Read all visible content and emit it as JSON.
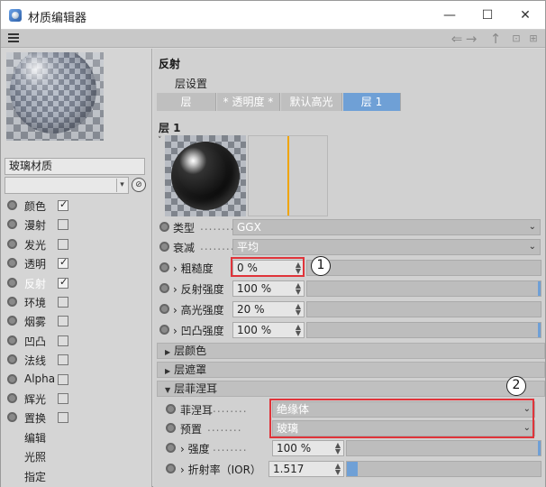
{
  "window": {
    "title": "材质编辑器",
    "minimize": "—",
    "maximize": "☐",
    "close": "✕"
  },
  "toolbar": {
    "menu_icon": "hamburger-icon",
    "back": "⇐",
    "forward": "→",
    "up": "↑",
    "lock": "🔒",
    "new": "⊞"
  },
  "material": {
    "name": "玻璃材质",
    "select_arrow": "▾",
    "pick_icon": "⊘"
  },
  "channels": [
    {
      "label": "颜色",
      "radio": true,
      "checkbox": true,
      "checked": true
    },
    {
      "label": "漫射",
      "radio": true,
      "checkbox": true,
      "checked": false
    },
    {
      "label": "发光",
      "radio": true,
      "checkbox": true,
      "checked": false
    },
    {
      "label": "透明",
      "radio": true,
      "checkbox": true,
      "checked": true
    },
    {
      "label": "反射",
      "radio": true,
      "checkbox": true,
      "checked": true,
      "active": true
    },
    {
      "label": "环境",
      "radio": true,
      "checkbox": true,
      "checked": false
    },
    {
      "label": "烟雾",
      "radio": true,
      "checkbox": true,
      "checked": false
    },
    {
      "label": "凹凸",
      "radio": true,
      "checkbox": true,
      "checked": false
    },
    {
      "label": "法线",
      "radio": true,
      "checkbox": true,
      "checked": false
    },
    {
      "label": "Alpha",
      "radio": true,
      "checkbox": true,
      "checked": false
    },
    {
      "label": "辉光",
      "radio": true,
      "checkbox": true,
      "checked": false
    },
    {
      "label": "置换",
      "radio": true,
      "checkbox": true,
      "checked": false
    },
    {
      "label": "编辑",
      "radio": false,
      "checkbox": false
    },
    {
      "label": "光照",
      "radio": false,
      "checkbox": false
    },
    {
      "label": "指定",
      "radio": false,
      "checkbox": false
    }
  ],
  "reflect": {
    "section_title": "反射",
    "layer_settings": "层设置",
    "tabs": [
      "层",
      "* 透明度 *",
      "默认高光",
      "层 1"
    ],
    "layer_title": "层 1",
    "chevron": "˅",
    "type_label": "类型",
    "type_value": "GGX",
    "atten_label": "衰减",
    "atten_value": "平均",
    "roughness_label": "› 粗糙度",
    "roughness_value": "0 %",
    "roughness_fill": 0,
    "reflect_strength_label": "› 反射强度",
    "reflect_strength_value": "100 %",
    "reflect_strength_fill": 1.0,
    "spec_strength_label": "› 高光强度",
    "spec_strength_value": "20 %",
    "spec_strength_fill": 0.2,
    "bump_strength_label": "› 凹凸强度",
    "bump_strength_value": "100 %",
    "bump_strength_fill": 1.0,
    "layer_color": "层颜色",
    "layer_mask": "层遮罩",
    "fresnel_section": "层菲涅耳",
    "fresnel_label": "菲涅耳",
    "fresnel_value": "绝缘体",
    "preset_label": "预置",
    "preset_value": "玻璃",
    "strength_label": "› 强度",
    "strength_value": "100 %",
    "strength_fill": 1.0,
    "ior_label": "› 折射率（IOR）",
    "ior_value": "1.517",
    "dots": "........",
    "dd_arrow": "⌄"
  },
  "callouts": [
    "1",
    "2"
  ],
  "colors": {
    "accent": "#6fa0d6",
    "highlight_box": "#e0343a",
    "curve_line": "#f0a400"
  }
}
